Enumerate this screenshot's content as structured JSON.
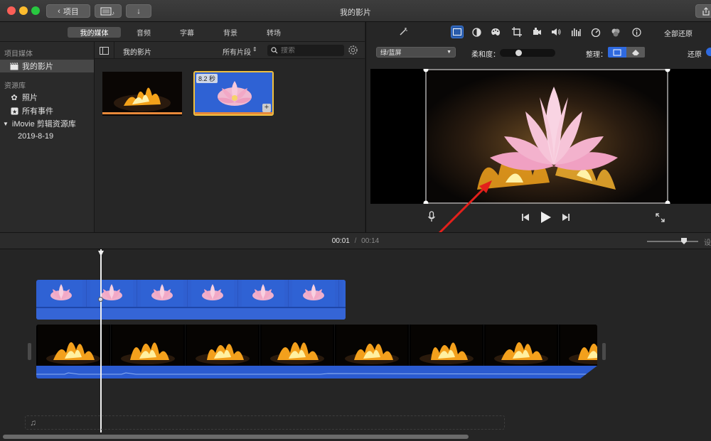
{
  "window": {
    "title": "我的影片",
    "back_button_label": "项目",
    "colors": {
      "close": "#fc5f57",
      "minimize": "#fdbc2e",
      "zoom": "#28c840",
      "accent": "#2f62d4"
    }
  },
  "media_tabs": [
    "我的媒体",
    "音频",
    "字幕",
    "背景",
    "转场"
  ],
  "sidebar": {
    "project_media_header": "项目媒体",
    "project_item": "我的影片",
    "library_header": "资源库",
    "library_items": [
      "照片",
      "所有事件"
    ],
    "library_name": "iMovie 剪辑资源库",
    "event_name": "2019-8-19"
  },
  "browser": {
    "title": "我的影片",
    "filter": "所有片段",
    "search_placeholder": "搜索",
    "clips": [
      {
        "name": "fire-clip",
        "duration": ""
      },
      {
        "name": "lotus-clip",
        "duration": "8.2 秒"
      }
    ]
  },
  "viewer": {
    "reset_all": "全部还原",
    "effect_select": "绿/蓝屏",
    "softness_label": "柔和度：",
    "softness_value": 0.3,
    "cleanup_label": "整理：",
    "reset_label": "还原"
  },
  "timeline": {
    "current_time": "00:01",
    "separator": "/",
    "total_time": "00:14",
    "zoom_value": 0.75,
    "overlay_frames": 7,
    "main_frames": 8
  }
}
